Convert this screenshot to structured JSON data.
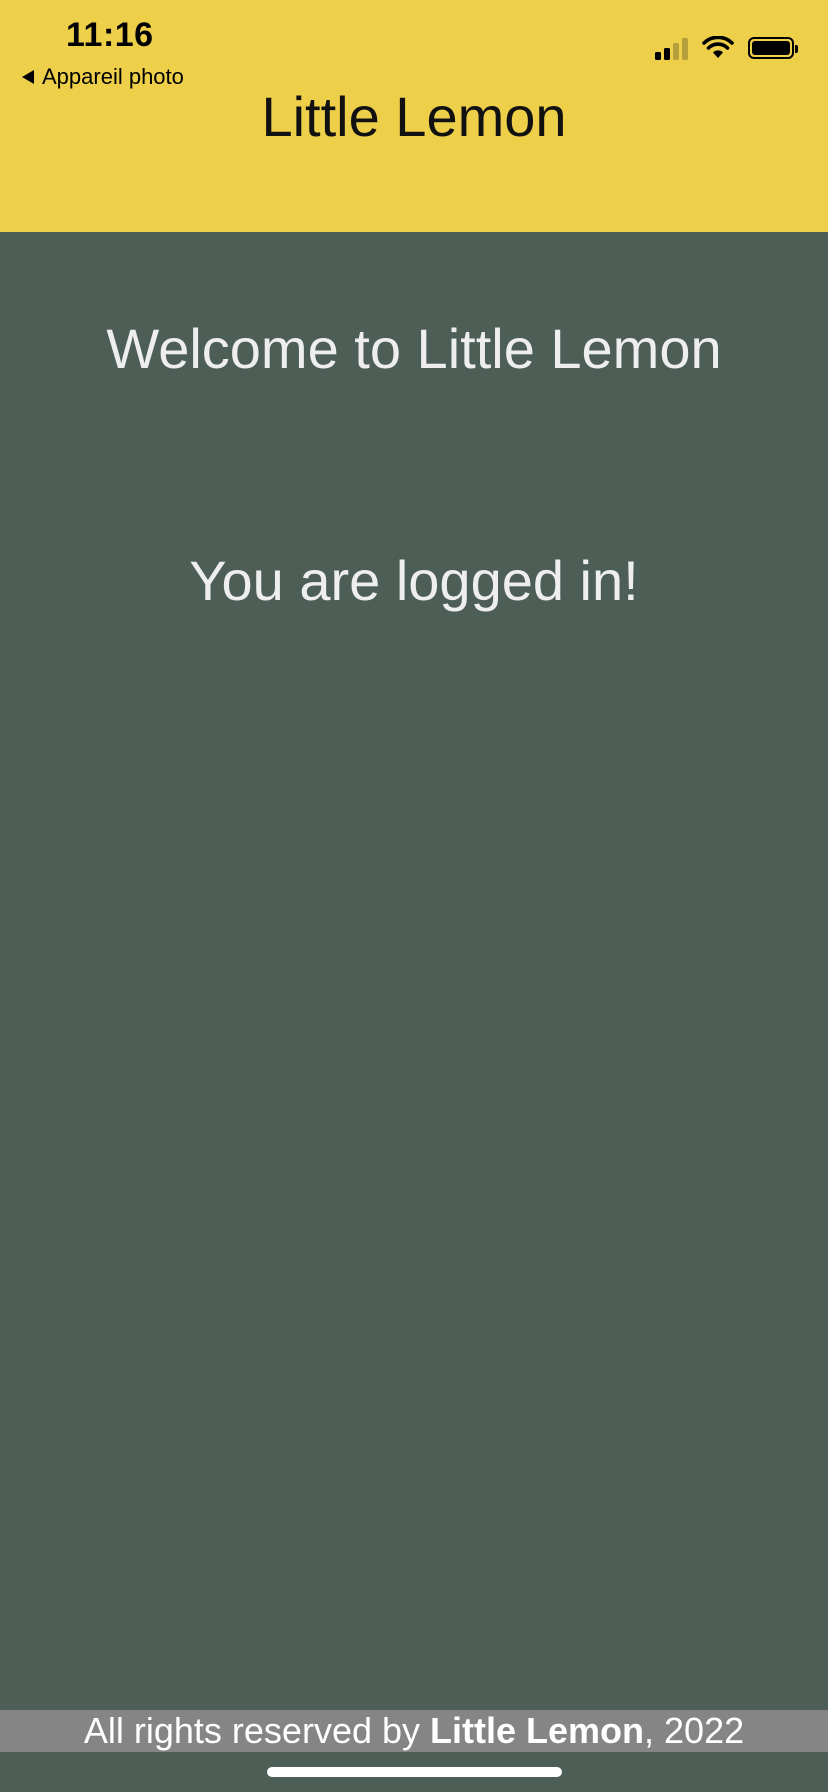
{
  "status_bar": {
    "time": "11:16",
    "back_label": "Appareil photo",
    "icons": [
      "cellular-signal-icon",
      "wifi-icon",
      "battery-icon"
    ]
  },
  "header": {
    "title": "Little Lemon",
    "background_color": "#eecf4a"
  },
  "main": {
    "welcome_text": "Welcome to Little Lemon",
    "status_message": "You are logged in!",
    "background_color": "#4d5e57"
  },
  "footer": {
    "prefix": "All rights reserved by ",
    "brand": "Little Lemon",
    "suffix": ", 2022",
    "background_color": "#858585"
  }
}
